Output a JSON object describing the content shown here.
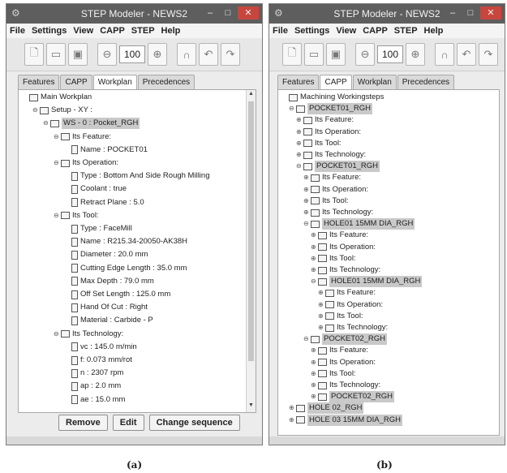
{
  "window_a": {
    "title": "STEP Modeler - NEWS2",
    "menu": [
      "File",
      "Settings",
      "View",
      "CAPP",
      "STEP",
      "Help"
    ],
    "zoom": "100",
    "tabs": [
      {
        "label": "Features",
        "active": false
      },
      {
        "label": "CAPP",
        "active": false
      },
      {
        "label": "Workplan",
        "active": true
      },
      {
        "label": "Precedences",
        "active": false
      }
    ],
    "tree": [
      {
        "label": "Main Workplan",
        "depth": 0,
        "icon": "folder",
        "expander": ""
      },
      {
        "label": "Setup - XY :",
        "depth": 1,
        "icon": "folder",
        "expander": "⊖"
      },
      {
        "label": "WS - 0 : Pocket_RGH",
        "depth": 2,
        "icon": "folder",
        "expander": "⊖",
        "selected": true
      },
      {
        "label": "Its Feature:",
        "depth": 3,
        "icon": "folder",
        "expander": "⊖"
      },
      {
        "label": "Name : POCKET01",
        "depth": 4,
        "icon": "doc",
        "expander": ""
      },
      {
        "label": "Its Operation:",
        "depth": 3,
        "icon": "folder",
        "expander": "⊖"
      },
      {
        "label": "Type : Bottom And Side Rough Milling",
        "depth": 4,
        "icon": "doc",
        "expander": ""
      },
      {
        "label": "Coolant : true",
        "depth": 4,
        "icon": "doc",
        "expander": ""
      },
      {
        "label": "Retract Plane : 5.0",
        "depth": 4,
        "icon": "doc",
        "expander": ""
      },
      {
        "label": "Its Tool:",
        "depth": 3,
        "icon": "folder",
        "expander": "⊖"
      },
      {
        "label": "Type : FaceMill",
        "depth": 4,
        "icon": "doc",
        "expander": ""
      },
      {
        "label": "Name : R215.34-20050-AK38H",
        "depth": 4,
        "icon": "doc",
        "expander": ""
      },
      {
        "label": "Diameter : 20.0 mm",
        "depth": 4,
        "icon": "doc",
        "expander": ""
      },
      {
        "label": "Cutting Edge Length : 35.0 mm",
        "depth": 4,
        "icon": "doc",
        "expander": ""
      },
      {
        "label": "Max Depth : 79.0 mm",
        "depth": 4,
        "icon": "doc",
        "expander": ""
      },
      {
        "label": "Off Set Length : 125.0 mm",
        "depth": 4,
        "icon": "doc",
        "expander": ""
      },
      {
        "label": "Hand Of Cut : Right",
        "depth": 4,
        "icon": "doc",
        "expander": ""
      },
      {
        "label": "Material : Carbide - P",
        "depth": 4,
        "icon": "doc",
        "expander": ""
      },
      {
        "label": "Its Technology:",
        "depth": 3,
        "icon": "folder",
        "expander": "⊖"
      },
      {
        "label": "vc : 145.0 m/min",
        "depth": 4,
        "icon": "doc",
        "expander": ""
      },
      {
        "label": "f: 0.073 mm/rot",
        "depth": 4,
        "icon": "doc",
        "expander": ""
      },
      {
        "label": "n : 2307 rpm",
        "depth": 4,
        "icon": "doc",
        "expander": ""
      },
      {
        "label": "ap : 2.0 mm",
        "depth": 4,
        "icon": "doc",
        "expander": ""
      },
      {
        "label": "ae : 15.0 mm",
        "depth": 4,
        "icon": "doc",
        "expander": ""
      }
    ],
    "buttons": {
      "remove": "Remove",
      "edit": "Edit",
      "change_sequence": "Change sequence"
    },
    "caption": "(a)"
  },
  "window_b": {
    "title": "STEP Modeler - NEWS2",
    "menu": [
      "File",
      "Settings",
      "View",
      "CAPP",
      "STEP",
      "Help"
    ],
    "zoom": "100",
    "tabs": [
      {
        "label": "Features",
        "active": false
      },
      {
        "label": "CAPP",
        "active": true
      },
      {
        "label": "Workplan",
        "active": false
      },
      {
        "label": "Precedences",
        "active": false
      }
    ],
    "tree": [
      {
        "label": "Machining Workingsteps",
        "depth": 0,
        "icon": "folder",
        "expander": ""
      },
      {
        "label": "POCKET01_RGH",
        "depth": 1,
        "icon": "folder",
        "expander": "⊖",
        "selected": true
      },
      {
        "label": "Its Feature:",
        "depth": 2,
        "icon": "folder",
        "expander": "⊕"
      },
      {
        "label": "Its Operation:",
        "depth": 2,
        "icon": "folder",
        "expander": "⊕"
      },
      {
        "label": "Its Tool:",
        "depth": 2,
        "icon": "folder",
        "expander": "⊕"
      },
      {
        "label": "Its Technology:",
        "depth": 2,
        "icon": "folder",
        "expander": "⊕"
      },
      {
        "label": "POCKET01_RGH",
        "depth": 2,
        "icon": "folder",
        "expander": "⊖",
        "selected": true
      },
      {
        "label": "Its Feature:",
        "depth": 3,
        "icon": "folder",
        "expander": "⊕"
      },
      {
        "label": "Its Operation:",
        "depth": 3,
        "icon": "folder",
        "expander": "⊕"
      },
      {
        "label": "Its Tool:",
        "depth": 3,
        "icon": "folder",
        "expander": "⊕"
      },
      {
        "label": "Its Technology:",
        "depth": 3,
        "icon": "folder",
        "expander": "⊕"
      },
      {
        "label": "HOLE01 15MM DIA_RGH",
        "depth": 3,
        "icon": "folder",
        "expander": "⊖",
        "selected": true
      },
      {
        "label": "Its Feature:",
        "depth": 4,
        "icon": "folder",
        "expander": "⊕"
      },
      {
        "label": "Its Operation:",
        "depth": 4,
        "icon": "folder",
        "expander": "⊕"
      },
      {
        "label": "Its Tool:",
        "depth": 4,
        "icon": "folder",
        "expander": "⊕"
      },
      {
        "label": "Its Technology:",
        "depth": 4,
        "icon": "folder",
        "expander": "⊕"
      },
      {
        "label": "HOLE01 15MM DIA_RGH",
        "depth": 4,
        "icon": "folder",
        "expander": "⊖",
        "selected": true
      },
      {
        "label": "Its Feature:",
        "depth": 5,
        "icon": "folder",
        "expander": "⊕"
      },
      {
        "label": "Its Operation:",
        "depth": 5,
        "icon": "folder",
        "expander": "⊕"
      },
      {
        "label": "Its Tool:",
        "depth": 5,
        "icon": "folder",
        "expander": "⊕"
      },
      {
        "label": "Its Technology:",
        "depth": 5,
        "icon": "folder",
        "expander": "⊕"
      },
      {
        "label": "POCKET02_RGH",
        "depth": 3,
        "icon": "folder",
        "expander": "⊖",
        "selected": true
      },
      {
        "label": "Its Feature:",
        "depth": 4,
        "icon": "folder",
        "expander": "⊕"
      },
      {
        "label": "Its Operation:",
        "depth": 4,
        "icon": "folder",
        "expander": "⊕"
      },
      {
        "label": "Its Tool:",
        "depth": 4,
        "icon": "folder",
        "expander": "⊕"
      },
      {
        "label": "Its Technology:",
        "depth": 4,
        "icon": "folder",
        "expander": "⊕"
      },
      {
        "label": "POCKET02_RGH",
        "depth": 4,
        "icon": "folder",
        "expander": "⊕",
        "selected": true
      },
      {
        "label": "HOLE 02_RGH",
        "depth": 1,
        "icon": "folder",
        "expander": "⊕",
        "selected": true
      },
      {
        "label": "HOLE 03 15MM DIA_RGH",
        "depth": 1,
        "icon": "folder",
        "expander": "⊕",
        "selected": true
      }
    ],
    "caption": "(b)"
  }
}
